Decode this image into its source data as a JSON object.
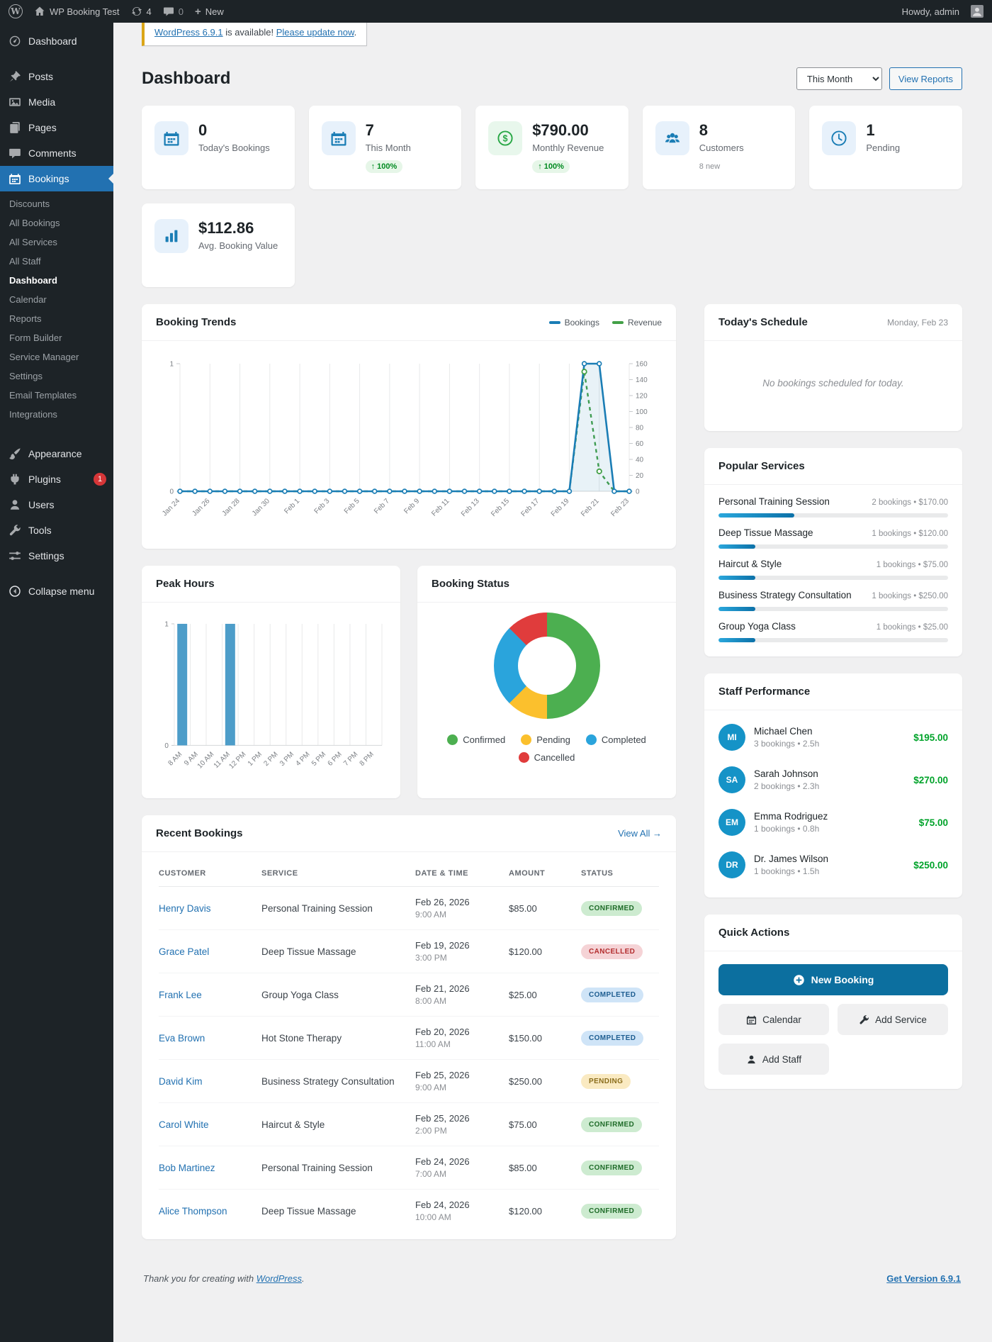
{
  "admin_bar": {
    "site_name": "WP Booking Test",
    "updates_count": "4",
    "comments_count": "0",
    "new_label": "New",
    "howdy": "Howdy, admin"
  },
  "sidebar": {
    "menu_top": [
      {
        "id": "dashboard",
        "label": "Dashboard",
        "icon": "dashboard"
      },
      {
        "id": "posts",
        "label": "Posts",
        "icon": "pin",
        "gap_before": true
      },
      {
        "id": "media",
        "label": "Media",
        "icon": "media"
      },
      {
        "id": "pages",
        "label": "Pages",
        "icon": "pages"
      },
      {
        "id": "comments",
        "label": "Comments",
        "icon": "comments"
      },
      {
        "id": "bookings",
        "label": "Bookings",
        "icon": "calendar",
        "active": true
      }
    ],
    "bookings_submenu": [
      "Discounts",
      "All Bookings",
      "All Services",
      "All Staff",
      "Dashboard",
      "Calendar",
      "Reports",
      "Form Builder",
      "Service Manager",
      "Settings",
      "Email Templates",
      "Integrations"
    ],
    "submenu_current": "Dashboard",
    "menu_bottom": [
      {
        "id": "appearance",
        "label": "Appearance",
        "icon": "appearance",
        "gap_before": true
      },
      {
        "id": "plugins",
        "label": "Plugins",
        "icon": "plugins",
        "badge": "1"
      },
      {
        "id": "users",
        "label": "Users",
        "icon": "users"
      },
      {
        "id": "tools",
        "label": "Tools",
        "icon": "tools"
      },
      {
        "id": "settings",
        "label": "Settings",
        "icon": "settings"
      },
      {
        "id": "collapse",
        "label": "Collapse menu",
        "icon": "collapse",
        "gap_before": true
      }
    ]
  },
  "notice": {
    "link1": "WordPress 6.9.1",
    "mid": " is available! ",
    "link2": "Please update now",
    "end": "."
  },
  "header": {
    "title": "Dashboard",
    "period_selected": "This Month",
    "view_reports": "View Reports"
  },
  "stats": [
    {
      "icon": "calendar",
      "tint": "blue",
      "value": "0",
      "label": "Today's Bookings"
    },
    {
      "icon": "calendar",
      "tint": "blue",
      "value": "7",
      "label": "This Month",
      "badge": "↑ 100%",
      "badge_type": "up"
    },
    {
      "icon": "dollar",
      "tint": "green",
      "value": "$790.00",
      "label": "Monthly Revenue",
      "badge": "↑ 100%",
      "badge_type": "up"
    },
    {
      "icon": "people",
      "tint": "blue",
      "value": "8",
      "label": "Customers",
      "badge": "8 new",
      "badge_type": "muted"
    },
    {
      "icon": "clock",
      "tint": "blue",
      "value": "1",
      "label": "Pending"
    },
    {
      "icon": "chart",
      "tint": "blue",
      "value": "$112.86",
      "label": "Avg. Booking Value"
    }
  ],
  "panels": {
    "trends": {
      "title": "Booking Trends"
    },
    "schedule": {
      "title": "Today's Schedule",
      "date": "Monday, Feb 23",
      "empty": "No bookings scheduled for today."
    },
    "popular": {
      "title": "Popular Services",
      "items": [
        {
          "name": "Personal Training Session",
          "meta": "2 bookings • $170.00",
          "pct": 33
        },
        {
          "name": "Deep Tissue Massage",
          "meta": "1 bookings • $120.00",
          "pct": 16
        },
        {
          "name": "Haircut & Style",
          "meta": "1 bookings • $75.00",
          "pct": 16
        },
        {
          "name": "Business Strategy Consultation",
          "meta": "1 bookings • $250.00",
          "pct": 16
        },
        {
          "name": "Group Yoga Class",
          "meta": "1 bookings • $25.00",
          "pct": 16
        }
      ]
    },
    "peak": {
      "title": "Peak Hours"
    },
    "status": {
      "title": "Booking Status"
    },
    "staff": {
      "title": "Staff Performance",
      "items": [
        {
          "initials": "MI",
          "name": "Michael Chen",
          "meta": "3 bookings • 2.5h",
          "amount": "$195.00"
        },
        {
          "initials": "SA",
          "name": "Sarah Johnson",
          "meta": "2 bookings • 2.3h",
          "amount": "$270.00"
        },
        {
          "initials": "EM",
          "name": "Emma Rodriguez",
          "meta": "1 bookings • 0.8h",
          "amount": "$75.00"
        },
        {
          "initials": "DR",
          "name": "Dr. James Wilson",
          "meta": "1 bookings • 1.5h",
          "amount": "$250.00"
        }
      ]
    },
    "quick": {
      "title": "Quick Actions",
      "new_booking": "New Booking",
      "calendar": "Calendar",
      "add_service": "Add Service",
      "add_staff": "Add Staff"
    },
    "recent": {
      "title": "Recent Bookings",
      "view_all": "View All →",
      "columns": [
        "CUSTOMER",
        "SERVICE",
        "DATE & TIME",
        "AMOUNT",
        "STATUS"
      ],
      "rows": [
        {
          "customer": "Henry Davis",
          "service": "Personal Training Session",
          "date": "Feb 26, 2026",
          "time": "9:00 AM",
          "amount": "$85.00",
          "status": "CONFIRMED",
          "status_type": "confirmed"
        },
        {
          "customer": "Grace Patel",
          "service": "Deep Tissue Massage",
          "date": "Feb 19, 2026",
          "time": "3:00 PM",
          "amount": "$120.00",
          "status": "CANCELLED",
          "status_type": "cancelled"
        },
        {
          "customer": "Frank Lee",
          "service": "Group Yoga Class",
          "date": "Feb 21, 2026",
          "time": "8:00 AM",
          "amount": "$25.00",
          "status": "COMPLETED",
          "status_type": "completed"
        },
        {
          "customer": "Eva Brown",
          "service": "Hot Stone Therapy",
          "date": "Feb 20, 2026",
          "time": "11:00 AM",
          "amount": "$150.00",
          "status": "COMPLETED",
          "status_type": "completed"
        },
        {
          "customer": "David Kim",
          "service": "Business Strategy Consultation",
          "date": "Feb 25, 2026",
          "time": "9:00 AM",
          "amount": "$250.00",
          "status": "PENDING",
          "status_type": "pending"
        },
        {
          "customer": "Carol White",
          "service": "Haircut & Style",
          "date": "Feb 25, 2026",
          "time": "2:00 PM",
          "amount": "$75.00",
          "status": "CONFIRMED",
          "status_type": "confirmed"
        },
        {
          "customer": "Bob Martinez",
          "service": "Personal Training Session",
          "date": "Feb 24, 2026",
          "time": "7:00 AM",
          "amount": "$85.00",
          "status": "CONFIRMED",
          "status_type": "confirmed"
        },
        {
          "customer": "Alice Thompson",
          "service": "Deep Tissue Massage",
          "date": "Feb 24, 2026",
          "time": "10:00 AM",
          "amount": "$120.00",
          "status": "CONFIRMED",
          "status_type": "confirmed"
        }
      ]
    }
  },
  "chart_data": [
    {
      "id": "booking_trends",
      "type": "line",
      "title": "Booking Trends",
      "x": [
        "Jan 24",
        "Jan 25",
        "Jan 26",
        "Jan 27",
        "Jan 28",
        "Jan 29",
        "Jan 30",
        "Jan 31",
        "Feb 1",
        "Feb 2",
        "Feb 3",
        "Feb 4",
        "Feb 5",
        "Feb 6",
        "Feb 7",
        "Feb 8",
        "Feb 9",
        "Feb 10",
        "Feb 11",
        "Feb 12",
        "Feb 13",
        "Feb 14",
        "Feb 15",
        "Feb 16",
        "Feb 17",
        "Feb 18",
        "Feb 19",
        "Feb 20",
        "Feb 21",
        "Feb 22",
        "Feb 23"
      ],
      "tick_every": 2,
      "series": [
        {
          "name": "Bookings",
          "axis": "left",
          "color": "#1a7db5",
          "fill": "rgba(26,125,181,0.10)",
          "dashed": false,
          "values": [
            0,
            0,
            0,
            0,
            0,
            0,
            0,
            0,
            0,
            0,
            0,
            0,
            0,
            0,
            0,
            0,
            0,
            0,
            0,
            0,
            0,
            0,
            0,
            0,
            0,
            0,
            0,
            1,
            1,
            0,
            0
          ]
        },
        {
          "name": "Revenue",
          "axis": "right",
          "color": "#43a047",
          "dashed": true,
          "values": [
            0,
            0,
            0,
            0,
            0,
            0,
            0,
            0,
            0,
            0,
            0,
            0,
            0,
            0,
            0,
            0,
            0,
            0,
            0,
            0,
            0,
            0,
            0,
            0,
            0,
            0,
            0,
            150,
            25,
            0,
            0
          ]
        }
      ],
      "y_left": {
        "min": 0,
        "max": 1,
        "ticks": [
          0,
          1
        ]
      },
      "y_right": {
        "min": 0,
        "max": 160,
        "step": 20
      },
      "legend_position": "top-right",
      "grid": "vertical"
    },
    {
      "id": "peak_hours",
      "type": "bar",
      "title": "Peak Hours",
      "categories": [
        "8 AM",
        "9 AM",
        "10 AM",
        "11 AM",
        "12 PM",
        "1 PM",
        "2 PM",
        "3 PM",
        "4 PM",
        "5 PM",
        "6 PM",
        "7 PM",
        "8 PM"
      ],
      "values": [
        1,
        0,
        0,
        1,
        0,
        0,
        0,
        0,
        0,
        0,
        0,
        0,
        0
      ],
      "ylim": [
        0,
        1
      ],
      "color": "#4d9dc9"
    },
    {
      "id": "booking_status",
      "type": "donut",
      "title": "Booking Status",
      "slices": [
        {
          "label": "Confirmed",
          "value": 4,
          "color": "#4caf50"
        },
        {
          "label": "Pending",
          "value": 1,
          "color": "#fbc02d"
        },
        {
          "label": "Completed",
          "value": 2,
          "color": "#2aa4dc"
        },
        {
          "label": "Cancelled",
          "value": 1,
          "color": "#e03c3c"
        }
      ]
    }
  ],
  "footer": {
    "thanks_prefix": "Thank you for creating with ",
    "thanks_link": "WordPress",
    "thanks_suffix": ".",
    "version_link": "Get Version 6.9.1"
  },
  "colors": {
    "accent": "#2271b1",
    "primary_button": "#0c6f9f",
    "line_bookings": "#1a7db5",
    "line_revenue": "#43a047",
    "bar_blue": "#4d9dc9",
    "green": "#00a32a",
    "notice_border": "#dba617",
    "active_menu": "#2271b1"
  }
}
